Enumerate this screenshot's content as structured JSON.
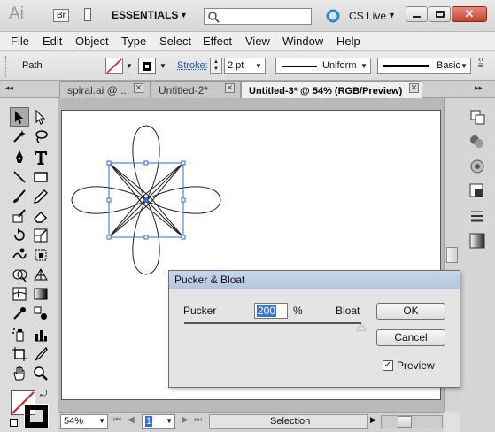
{
  "app": {
    "logo": "Ai",
    "bridge_label": "Br",
    "workspace": "ESSENTIALS",
    "search_placeholder": "",
    "cs_live": "CS Live"
  },
  "menu": [
    "File",
    "Edit",
    "Object",
    "Type",
    "Select",
    "Effect",
    "View",
    "Window",
    "Help"
  ],
  "control": {
    "selection_type": "Path",
    "stroke_label": "Stroke:",
    "stroke_weight": "2 pt",
    "profile": "Uniform",
    "brush": "Basic"
  },
  "tabs": [
    {
      "label": "spiral.ai @ ..."
    },
    {
      "label": "Untitled-2*"
    },
    {
      "label": "Untitled-3* @ 54% (RGB/Preview)"
    }
  ],
  "status": {
    "zoom": "54%",
    "page": "1",
    "tool": "Selection"
  },
  "dialog": {
    "title": "Pucker & Bloat",
    "left_label": "Pucker",
    "right_label": "Bloat",
    "value": "200",
    "unit": "%",
    "ok": "OK",
    "cancel": "Cancel",
    "preview_label": "Preview",
    "preview_checked": true,
    "slider_fraction": 1.0
  },
  "colors": {
    "selection": "#2d6fd9",
    "titlebar_dialog": "#b9c9e1"
  }
}
